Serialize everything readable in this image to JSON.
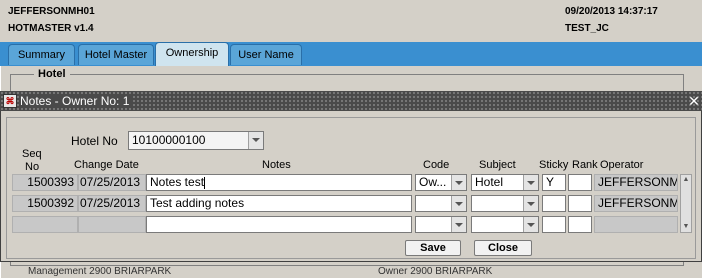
{
  "header": {
    "host": "JEFFERSONMH01",
    "app": "HOTMASTER v1.4",
    "datetime": "09/20/2013 14:37:17",
    "user": "TEST_JC"
  },
  "tabs": [
    "Summary",
    "Hotel Master",
    "Ownership",
    "User Name"
  ],
  "active_tab": "Ownership",
  "background": {
    "section_label": "Hotel",
    "bottom_left": "Management  2900 BRIARPARK",
    "bottom_right": "Owner  2900 BRIARPARK"
  },
  "dialog": {
    "title": "Notes - Owner No: 1",
    "hotel_no_label": "Hotel No",
    "hotel_no_value": "10100000100",
    "columns": {
      "seq": "Seq",
      "no": "No",
      "change_date": "Change Date",
      "notes": "Notes",
      "code": "Code",
      "subject": "Subject",
      "sticky": "Sticky",
      "rank": "Rank",
      "operator": "Operator"
    },
    "rows": [
      {
        "seq": "1500393",
        "date": "07/25/2013",
        "notes": "Notes test",
        "code": "Ow...",
        "subject": "Hotel",
        "sticky": "Y",
        "rank": "",
        "operator": "JEFFERSONM"
      },
      {
        "seq": "1500392",
        "date": "07/25/2013",
        "notes": "Test adding notes",
        "code": "",
        "subject": "",
        "sticky": "",
        "rank": "",
        "operator": "JEFFERSONM"
      },
      {
        "seq": "",
        "date": "",
        "notes": "",
        "code": "",
        "subject": "",
        "sticky": "",
        "rank": "",
        "operator": ""
      }
    ],
    "save_label": "Save",
    "close_label": "Close"
  },
  "colors": {
    "tab_band": "#3a8fd0",
    "dialog_title": "#4a4a4a",
    "window_bg": "#d4d0c8"
  }
}
